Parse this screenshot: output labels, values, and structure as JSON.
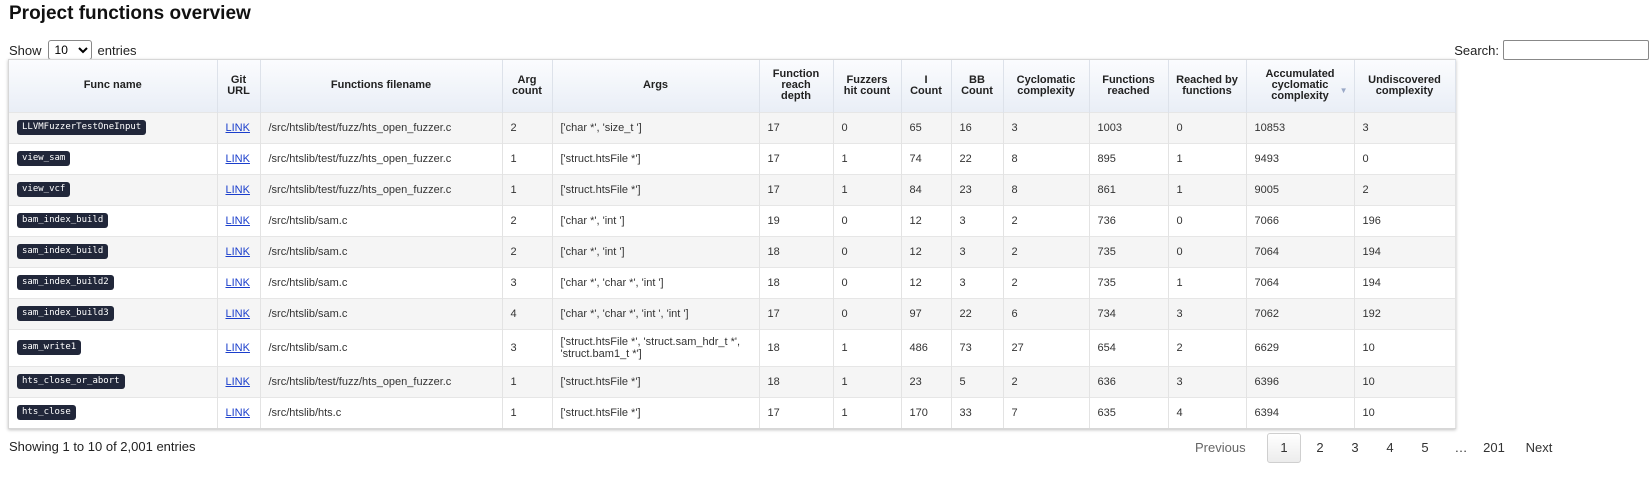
{
  "page": {
    "title": "Project functions overview"
  },
  "length_control": {
    "show_label": "Show",
    "selected": "10",
    "entries_label": "entries"
  },
  "search": {
    "label": "Search:",
    "value": ""
  },
  "columns": [
    "Func name",
    "Git URL",
    "Functions filename",
    "Arg count",
    "Args",
    "Function reach depth",
    "Fuzzers hit count",
    "I Count",
    "BB Count",
    "Cyclomatic complexity",
    "Functions reached",
    "Reached by functions",
    "Accumulated cyclomatic complexity",
    "Undiscovered complexity"
  ],
  "sort_indicator": "▼",
  "rows": [
    {
      "func": "LLVMFuzzerTestOneInput",
      "url": "LINK",
      "file": "/src/htslib/test/fuzz/hts_open_fuzzer.c",
      "argc": "2",
      "args": "['char *', 'size_t ']",
      "depth": "17",
      "fuzzers": "0",
      "icount": "65",
      "bb": "16",
      "cyclo": "3",
      "reached": "1003",
      "reached_by": "0",
      "acc": "10853",
      "undisc": "3"
    },
    {
      "func": "view_sam",
      "url": "LINK",
      "file": "/src/htslib/test/fuzz/hts_open_fuzzer.c",
      "argc": "1",
      "args": "['struct.htsFile *']",
      "depth": "17",
      "fuzzers": "1",
      "icount": "74",
      "bb": "22",
      "cyclo": "8",
      "reached": "895",
      "reached_by": "1",
      "acc": "9493",
      "undisc": "0"
    },
    {
      "func": "view_vcf",
      "url": "LINK",
      "file": "/src/htslib/test/fuzz/hts_open_fuzzer.c",
      "argc": "1",
      "args": "['struct.htsFile *']",
      "depth": "17",
      "fuzzers": "1",
      "icount": "84",
      "bb": "23",
      "cyclo": "8",
      "reached": "861",
      "reached_by": "1",
      "acc": "9005",
      "undisc": "2"
    },
    {
      "func": "bam_index_build",
      "url": "LINK",
      "file": "/src/htslib/sam.c",
      "argc": "2",
      "args": "['char *', 'int ']",
      "depth": "19",
      "fuzzers": "0",
      "icount": "12",
      "bb": "3",
      "cyclo": "2",
      "reached": "736",
      "reached_by": "0",
      "acc": "7066",
      "undisc": "196"
    },
    {
      "func": "sam_index_build",
      "url": "LINK",
      "file": "/src/htslib/sam.c",
      "argc": "2",
      "args": "['char *', 'int ']",
      "depth": "18",
      "fuzzers": "0",
      "icount": "12",
      "bb": "3",
      "cyclo": "2",
      "reached": "735",
      "reached_by": "0",
      "acc": "7064",
      "undisc": "194"
    },
    {
      "func": "sam_index_build2",
      "url": "LINK",
      "file": "/src/htslib/sam.c",
      "argc": "3",
      "args": "['char *', 'char *', 'int ']",
      "depth": "18",
      "fuzzers": "0",
      "icount": "12",
      "bb": "3",
      "cyclo": "2",
      "reached": "735",
      "reached_by": "1",
      "acc": "7064",
      "undisc": "194"
    },
    {
      "func": "sam_index_build3",
      "url": "LINK",
      "file": "/src/htslib/sam.c",
      "argc": "4",
      "args": "['char *', 'char *', 'int ', 'int ']",
      "depth": "17",
      "fuzzers": "0",
      "icount": "97",
      "bb": "22",
      "cyclo": "6",
      "reached": "734",
      "reached_by": "3",
      "acc": "7062",
      "undisc": "192"
    },
    {
      "func": "sam_write1",
      "url": "LINK",
      "file": "/src/htslib/sam.c",
      "argc": "3",
      "args": "['struct.htsFile *', 'struct.sam_hdr_t *', 'struct.bam1_t *']",
      "depth": "18",
      "fuzzers": "1",
      "icount": "486",
      "bb": "73",
      "cyclo": "27",
      "reached": "654",
      "reached_by": "2",
      "acc": "6629",
      "undisc": "10"
    },
    {
      "func": "hts_close_or_abort",
      "url": "LINK",
      "file": "/src/htslib/test/fuzz/hts_open_fuzzer.c",
      "argc": "1",
      "args": "['struct.htsFile *']",
      "depth": "18",
      "fuzzers": "1",
      "icount": "23",
      "bb": "5",
      "cyclo": "2",
      "reached": "636",
      "reached_by": "3",
      "acc": "6396",
      "undisc": "10"
    },
    {
      "func": "hts_close",
      "url": "LINK",
      "file": "/src/htslib/hts.c",
      "argc": "1",
      "args": "['struct.htsFile *']",
      "depth": "17",
      "fuzzers": "1",
      "icount": "170",
      "bb": "33",
      "cyclo": "7",
      "reached": "635",
      "reached_by": "4",
      "acc": "6394",
      "undisc": "10"
    }
  ],
  "footer": {
    "info": "Showing 1 to 10 of 2,001 entries"
  },
  "pagination": {
    "previous": "Previous",
    "pages": [
      "1",
      "2",
      "3",
      "4",
      "5"
    ],
    "ellipsis": "…",
    "last": "201",
    "next": "Next",
    "current": "1"
  }
}
